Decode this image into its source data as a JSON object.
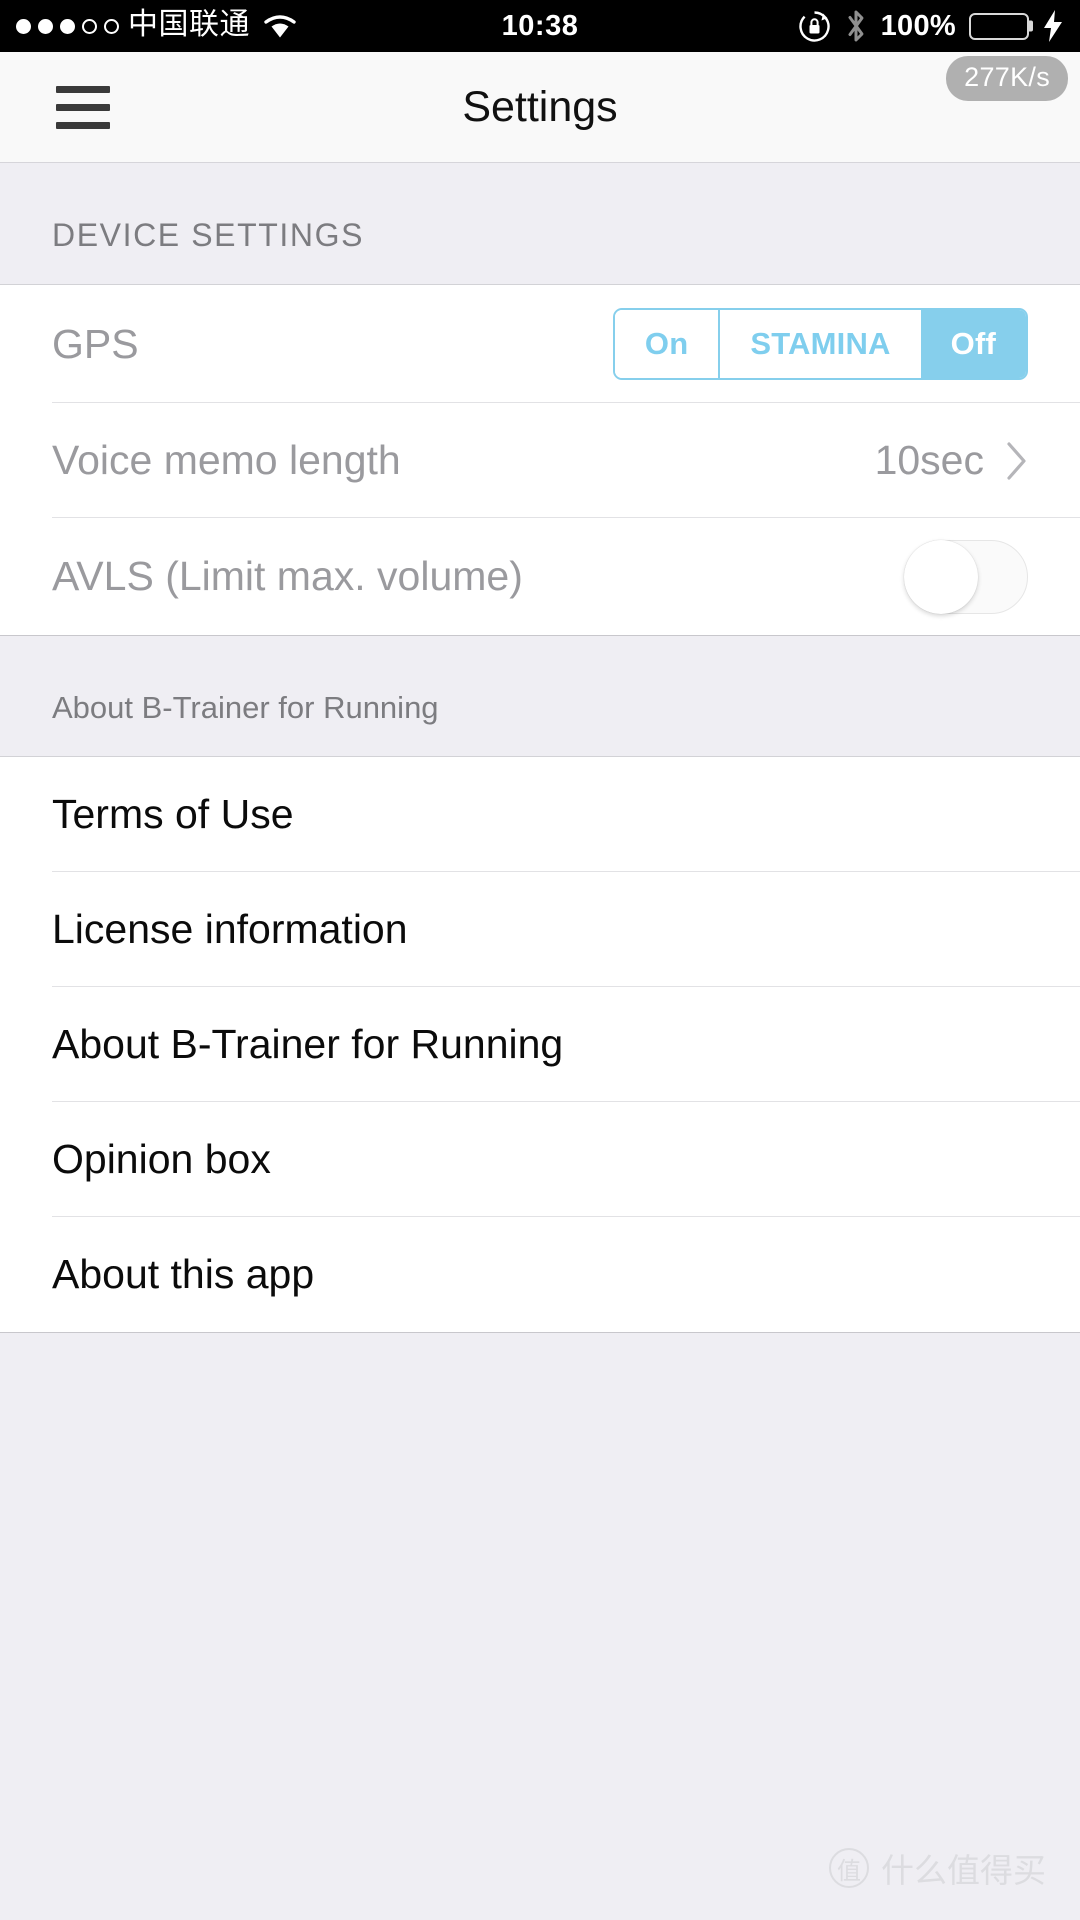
{
  "status_bar": {
    "signal_dots_filled": 3,
    "signal_dots_total": 5,
    "carrier": "中国联通",
    "wifi_icon": "wifi-icon",
    "time": "10:38",
    "rotation_lock_icon": "rotation-lock-icon",
    "bluetooth_icon": "bluetooth-icon",
    "battery_percent": "100%",
    "battery_level": 100,
    "battery_charging": true,
    "battery_color": "#4CD554"
  },
  "network_badge": {
    "label": "277K/s"
  },
  "navbar": {
    "menu_icon": "hamburger-menu-icon",
    "title": "Settings"
  },
  "device_section": {
    "header": "DEVICE SETTINGS",
    "gps": {
      "label": "GPS",
      "options": [
        "On",
        "STAMINA",
        "Off"
      ],
      "selected": "Off",
      "accent_color": "#86CFEC"
    },
    "voice_memo": {
      "label": "Voice memo length",
      "value": "10sec",
      "chevron_icon": "chevron-right-icon"
    },
    "avls": {
      "label": "AVLS (Limit max. volume)",
      "enabled": false
    }
  },
  "about_section": {
    "header": "About B-Trainer for Running",
    "items": [
      {
        "label": "Terms of Use"
      },
      {
        "label": "License information"
      },
      {
        "label": "About B-Trainer for Running"
      },
      {
        "label": "Opinion box"
      },
      {
        "label": "About this app"
      }
    ]
  },
  "watermark": {
    "mark": "值",
    "text": "什么值得买"
  }
}
